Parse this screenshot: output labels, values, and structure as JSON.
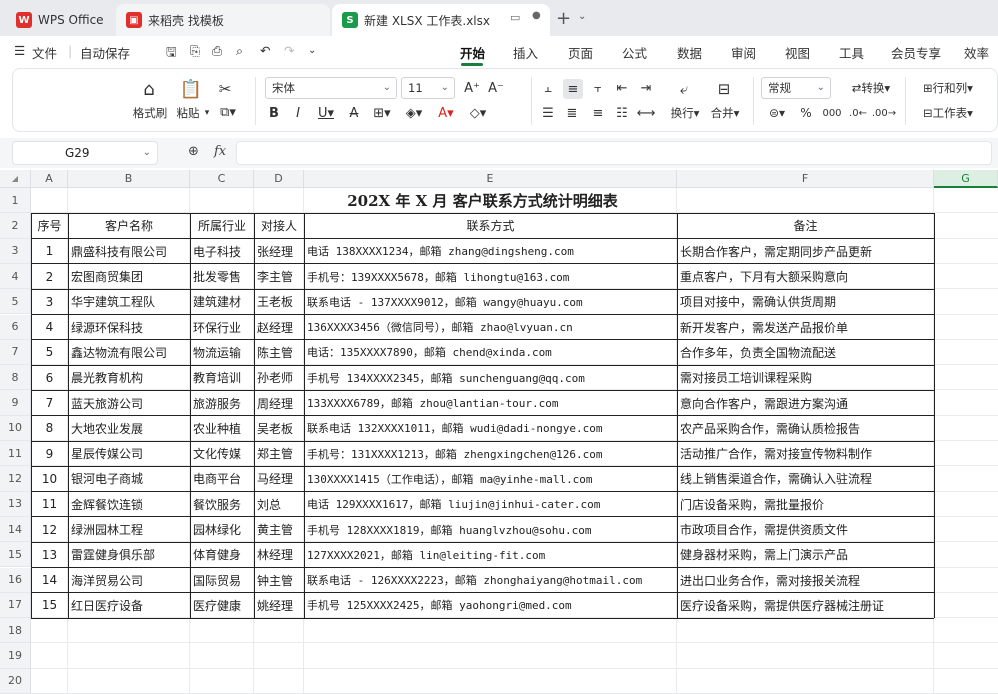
{
  "tabs": {
    "app": "WPS Office",
    "template": "来稻壳 找模板",
    "file": "新建 XLSX 工作表.xlsx",
    "file_badge": "S"
  },
  "menu": {
    "file": "文件",
    "autosave": "自动保存",
    "items": [
      "开始",
      "插入",
      "页面",
      "公式",
      "数据",
      "审阅",
      "视图",
      "工具",
      "会员专享",
      "效率"
    ]
  },
  "ribbon": {
    "format_painter": "格式刷",
    "paste": "粘贴",
    "font": "宋体",
    "font_size": "11",
    "wrap": "换行",
    "merge": "合并",
    "number_format": "常规",
    "convert": "转换",
    "rows_cols": "行和列",
    "worksheet": "工作表"
  },
  "formula_bar": {
    "name_box": "G29",
    "fx": "fx"
  },
  "colors": {
    "accent": "#1a7f3c",
    "wps_red": "#e0302d"
  },
  "columns": [
    "A",
    "B",
    "C",
    "D",
    "E",
    "F",
    "G"
  ],
  "rows": [
    "1",
    "2",
    "3",
    "4",
    "5",
    "6",
    "7",
    "8",
    "9",
    "10",
    "11",
    "12",
    "13",
    "14",
    "15",
    "16",
    "17",
    "18",
    "19",
    "20"
  ],
  "sheet": {
    "title": "202X 年 X 月 客户联系方式统计明细表",
    "headers": [
      "序号",
      "客户名称",
      "所属行业",
      "对接人",
      "联系方式",
      "备注"
    ],
    "data": [
      [
        "1",
        "鼎盛科技有限公司",
        "电子科技",
        "张经理",
        "电话 138XXXX1234，邮箱 zhang@dingsheng.com",
        "长期合作客户，需定期同步产品更新"
      ],
      [
        "2",
        "宏图商贸集团",
        "批发零售",
        "李主管",
        "手机号：139XXXX5678，邮箱 lihongtu@163.com",
        "重点客户，下月有大额采购意向"
      ],
      [
        "3",
        "华宇建筑工程队",
        "建筑建材",
        "王老板",
        "联系电话 - 137XXXX9012，邮箱 wangy@huayu.com",
        "项目对接中，需确认供货周期"
      ],
      [
        "4",
        "绿源环保科技",
        "环保行业",
        "赵经理",
        "136XXXX3456（微信同号），邮箱 zhao@lvyuan.cn",
        "新开发客户，需发送产品报价单"
      ],
      [
        "5",
        "鑫达物流有限公司",
        "物流运输",
        "陈主管",
        "电话：135XXXX7890，邮箱 chend@xinda.com",
        "合作多年，负责全国物流配送"
      ],
      [
        "6",
        "晨光教育机构",
        "教育培训",
        "孙老师",
        "手机号 134XXXX2345，邮箱 sunchenguang@qq.com",
        "需对接员工培训课程采购"
      ],
      [
        "7",
        "蓝天旅游公司",
        "旅游服务",
        "周经理",
        "133XXXX6789，邮箱 zhou@lantian-tour.com",
        "意向合作客户，需跟进方案沟通"
      ],
      [
        "8",
        "大地农业发展",
        "农业种植",
        "吴老板",
        "联系电话 132XXXX1011，邮箱 wudi@dadi-nongye.com",
        "农产品采购合作，需确认质检报告"
      ],
      [
        "9",
        "星辰传媒公司",
        "文化传媒",
        "郑主管",
        "手机号：131XXXX1213，邮箱 zhengxingchen@126.com",
        "活动推广合作，需对接宣传物料制作"
      ],
      [
        "10",
        "银河电子商城",
        "电商平台",
        "马经理",
        "130XXXX1415（工作电话），邮箱 ma@yinhe-mall.com",
        "线上销售渠道合作，需确认入驻流程"
      ],
      [
        "11",
        "金辉餐饮连锁",
        "餐饮服务",
        "刘总",
        "电话 129XXXX1617，邮箱 liujin@jinhui-cater.com",
        "门店设备采购，需批量报价"
      ],
      [
        "12",
        "绿洲园林工程",
        "园林绿化",
        "黄主管",
        "手机号 128XXXX1819，邮箱 huanglvzhou@sohu.com",
        "市政项目合作，需提供资质文件"
      ],
      [
        "13",
        "雷霆健身俱乐部",
        "体育健身",
        "林经理",
        "127XXXX2021，邮箱 lin@leiting-fit.com",
        "健身器材采购，需上门演示产品"
      ],
      [
        "14",
        "海洋贸易公司",
        "国际贸易",
        "钟主管",
        "联系电话 - 126XXXX2223，邮箱 zhonghaiyang@hotmail.com",
        "进出口业务合作，需对接报关流程"
      ],
      [
        "15",
        "红日医疗设备",
        "医疗健康",
        "姚经理",
        "手机号 125XXXX2425，邮箱 yaohongri@med.com",
        "医疗设备采购，需提供医疗器械注册证"
      ]
    ]
  }
}
